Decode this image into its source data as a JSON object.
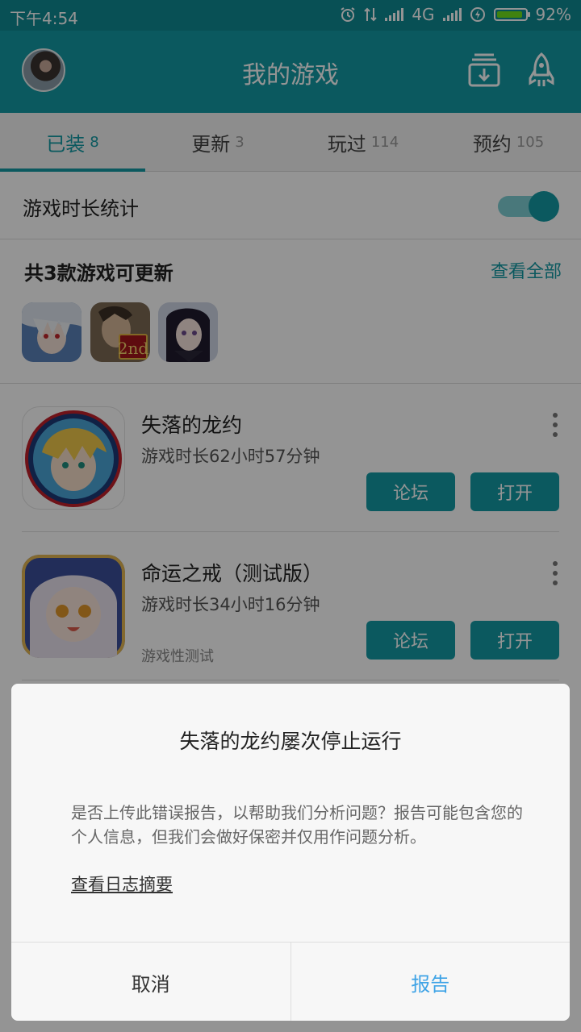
{
  "status_bar": {
    "time": "下午4:54",
    "network": "4G",
    "battery": "92%",
    "battery_level": 0.92
  },
  "header": {
    "title": "我的游戏"
  },
  "tabs": [
    {
      "label": "已装",
      "count": "8"
    },
    {
      "label": "更新",
      "count": "3"
    },
    {
      "label": "玩过",
      "count": "114"
    },
    {
      "label": "预约",
      "count": "105"
    }
  ],
  "stats": {
    "label": "游戏时长统计",
    "enabled": true
  },
  "updates": {
    "title": "共3款游戏可更新",
    "view_all": "查看全部",
    "thumb_badge": "2nd"
  },
  "games": [
    {
      "name": "失落的龙约",
      "playtime": "游戏时长62小时57分钟",
      "subtitle": "",
      "forum": "论坛",
      "open": "打开"
    },
    {
      "name": "命运之戒（测试版）",
      "playtime": "游戏时长34小时16分钟",
      "subtitle": "游戏性测试",
      "forum": "论坛",
      "open": "打开"
    }
  ],
  "dialog": {
    "title": "失落的龙约屡次停止运行",
    "message": "是否上传此错误报告，以帮助我们分析问题？报告可能包含您的个人信息，但我们会做好保密并仅用作问题分析。",
    "link": "查看日志摘要",
    "cancel": "取消",
    "report": "报告"
  },
  "colors": {
    "primary": "#139aa4",
    "statusbar": "#0e8a93",
    "report": "#3ea3e6"
  },
  "icons": [
    "alarm-icon",
    "data-transfer-icon",
    "signal-icon",
    "charging-icon",
    "battery-icon",
    "download-box-icon",
    "rocket-icon",
    "more-vertical-icon"
  ]
}
